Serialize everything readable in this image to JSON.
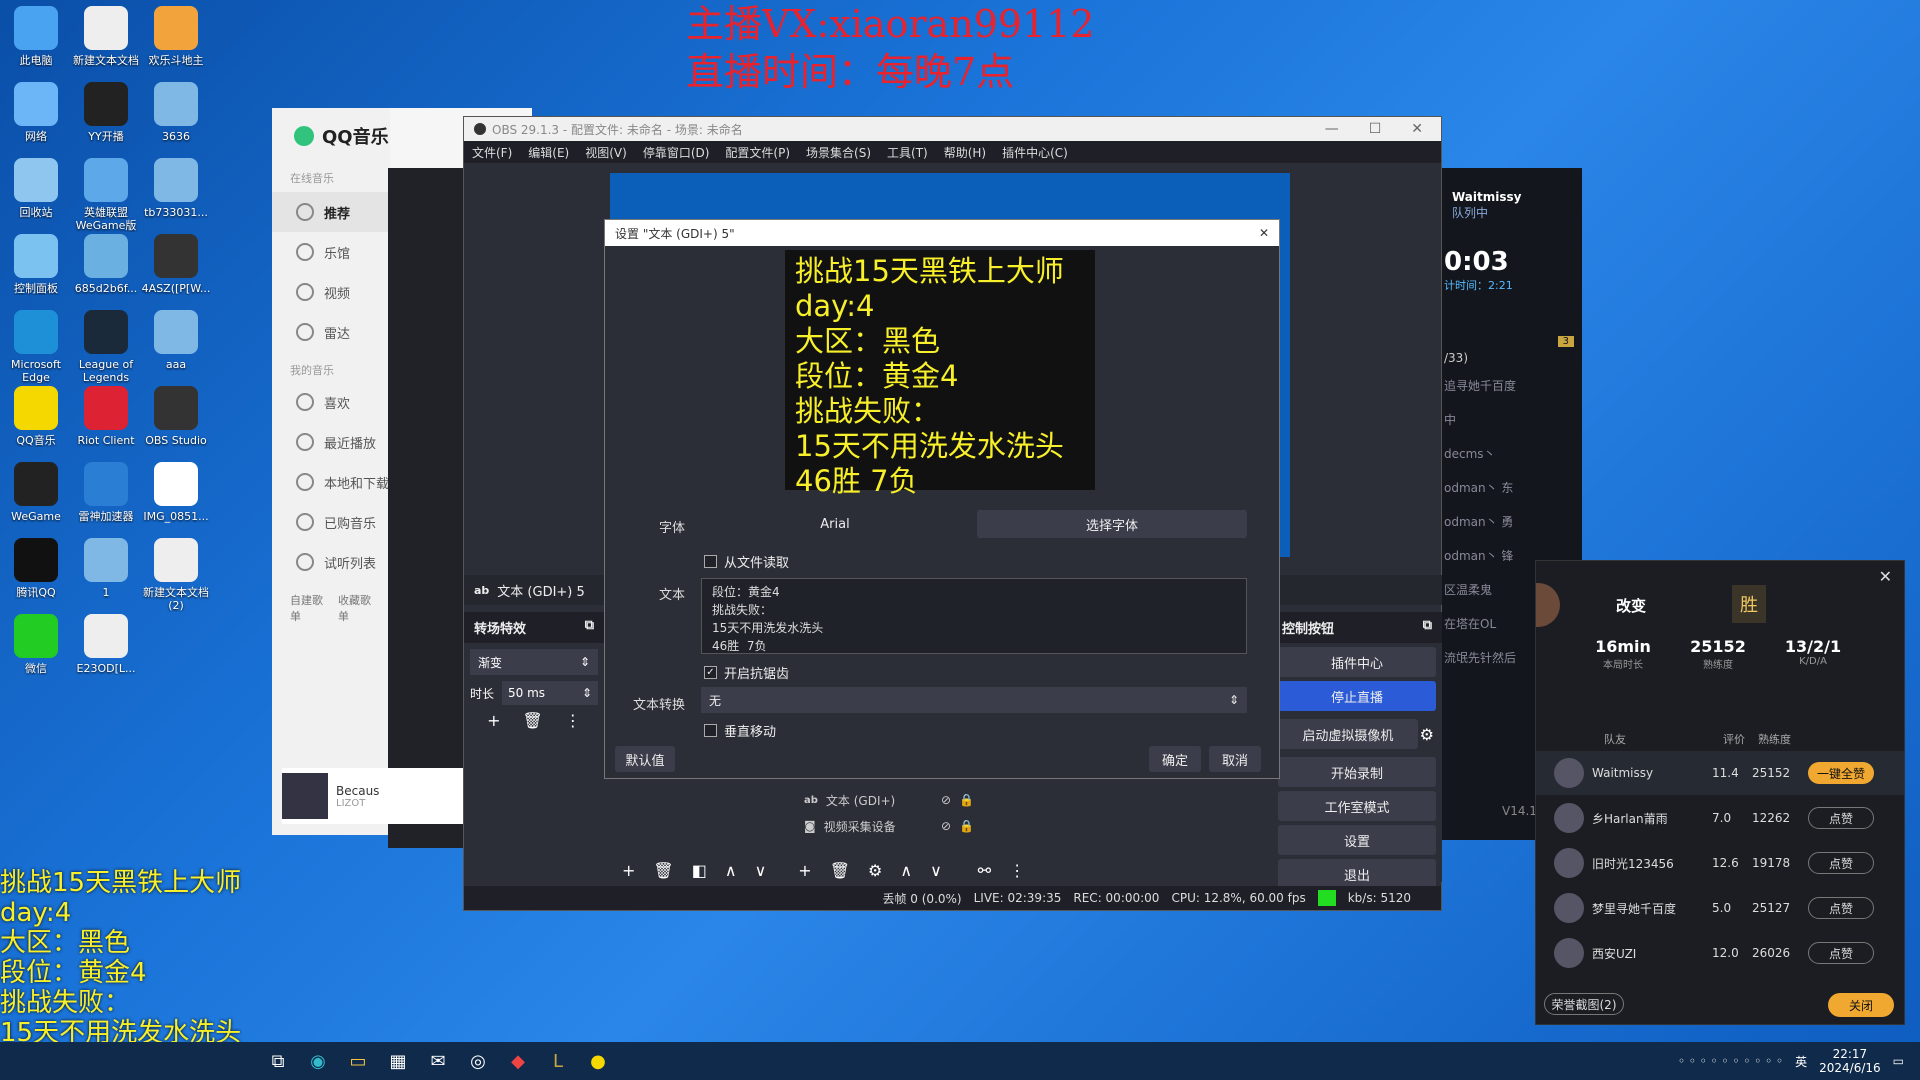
{
  "overlay_top": {
    "line1": "主播VX:xiaoran99112",
    "line2": "直播时间：每晚7点"
  },
  "desktop_icons": [
    {
      "label": "此电脑"
    },
    {
      "label": "新建文本文档"
    },
    {
      "label": "欢乐斗地主"
    },
    {
      "label": "网络"
    },
    {
      "label": "YY开播"
    },
    {
      "label": "3636"
    },
    {
      "label": "回收站"
    },
    {
      "label": "英雄联盟WeGame版"
    },
    {
      "label": "tb733031..."
    },
    {
      "label": "控制面板"
    },
    {
      "label": "685d2b6f..."
    },
    {
      "label": "4ASZ([P[W..."
    },
    {
      "label": "Microsoft Edge"
    },
    {
      "label": "League of Legends"
    },
    {
      "label": "aaa"
    },
    {
      "label": "QQ音乐"
    },
    {
      "label": "Riot Client"
    },
    {
      "label": "OBS Studio"
    },
    {
      "label": "WeGame"
    },
    {
      "label": "雷神加速器"
    },
    {
      "label": "IMG_0851..."
    },
    {
      "label": "腾讯QQ"
    },
    {
      "label": "1"
    },
    {
      "label": "新建文本文档 (2)"
    },
    {
      "label": "微信"
    },
    {
      "label": "E23OD[L..."
    }
  ],
  "qq_music": {
    "title": "QQ音乐",
    "section_online": "在线音乐",
    "items_online": [
      "推荐",
      "乐馆",
      "视频",
      "雷达"
    ],
    "section_mine": "我的音乐",
    "items_mine": [
      "喜欢",
      "最近播放",
      "本地和下载",
      "已购音乐",
      "试听列表"
    ],
    "tabs": [
      "自建歌单",
      "收藏歌单"
    ],
    "now_playing": {
      "title": "Becaus",
      "artist": "LIZOT"
    }
  },
  "obs": {
    "title": "OBS 29.1.3 - 配置文件: 未命名 - 场景: 未命名",
    "menu": [
      "文件(F)",
      "编辑(E)",
      "视图(V)",
      "停靠窗口(D)",
      "配置文件(P)",
      "场景集合(S)",
      "工具(T)",
      "帮助(H)",
      "插件中心(C)"
    ],
    "source_label": "文本 (GDI+) 5",
    "transitions_title": "转场特效",
    "transition_value": "渐变",
    "duration_label": "时长",
    "duration_value": "50 ms",
    "sources": [
      {
        "name": "文本 (GDI+)"
      },
      {
        "name": "视频采集设备"
      }
    ],
    "controls_title": "控制按钮",
    "controls": [
      "插件中心",
      "停止直播",
      "启动虚拟摄像机",
      "开始录制",
      "工作室模式",
      "设置",
      "退出"
    ],
    "status": {
      "dropped": "丢帧 0 (0.0%)",
      "live": "LIVE: 02:39:35",
      "rec": "REC: 00:00:00",
      "cpu": "CPU: 12.8%, 60.00 fps",
      "kbs": "kb/s: 5120"
    }
  },
  "dialog": {
    "title": "设置 \"文本 (GDI+) 5\"",
    "preview_lines": [
      "挑战15天黑铁上大师",
      "day:4",
      "大区：黑色",
      "段位：黄金4",
      "挑战失败：",
      "15天不用洗发水洗头",
      "46胜  7负"
    ],
    "font_label": "字体",
    "font_value": "Arial",
    "choose_font": "选择字体",
    "read_from_file": "从文件读取",
    "text_label": "文本",
    "text_value": "段位：黄金4\n挑战失败：\n15天不用洗发水洗头\n46胜  7负",
    "antialias": "开启抗锯齿",
    "transform_label": "文本转换",
    "transform_value": "无",
    "vertical": "垂直移动",
    "defaults": "默认值",
    "ok": "确定",
    "cancel": "取消"
  },
  "wegame": {
    "user": "Waitmissy",
    "status": "队列中",
    "timer": "0:03",
    "timer_sub": "计时间：2:21",
    "counter": "3",
    "ratio": "/33)",
    "list": [
      "追寻她千百度",
      "中",
      "decms丶",
      "odman丶 东",
      "odman丶 勇",
      "odman丶 锋",
      "区温柔鬼",
      "在塔在OL",
      "流氓先针然后"
    ],
    "version": "V14.12"
  },
  "lol_result": {
    "title": "改变",
    "badge": "胜",
    "stats": [
      {
        "value": "16min",
        "label": "本局时长"
      },
      {
        "value": "25152",
        "label": "熟练度"
      },
      {
        "value": "13/2/1",
        "label": "K/D/A"
      }
    ],
    "headers": [
      "队友",
      "评价",
      "熟练度"
    ],
    "players": [
      {
        "name": "Waitmissy",
        "score": "11.4",
        "mastery": "25152",
        "btn": "一键全赞"
      },
      {
        "name": "乡Harlan莆雨",
        "score": "7.0",
        "mastery": "12262",
        "btn": "点赞"
      },
      {
        "name": "旧时光123456",
        "score": "12.6",
        "mastery": "19178",
        "btn": "点赞"
      },
      {
        "name": "梦里寻她千百度",
        "score": "5.0",
        "mastery": "25127",
        "btn": "点赞"
      },
      {
        "name": "西安UZI",
        "score": "12.0",
        "mastery": "26026",
        "btn": "点赞"
      }
    ],
    "screenshot": "荣誉截图(2)",
    "close": "关闭"
  },
  "overlay_left": [
    "挑战15天黑铁上大师",
    "day:4",
    "大区：黑色",
    "段位：黄金4",
    "挑战失败：",
    "15天不用洗发水洗头",
    "46胜  7负"
  ],
  "taskbar": {
    "time": "22:17",
    "date": "2024/6/16",
    "ime": "英"
  },
  "colors": {
    "overlay_red": "#e8232d",
    "overlay_yellow": "#f7ef2a",
    "obs_blue": "#2c5bd8",
    "gold": "#f0a830"
  }
}
